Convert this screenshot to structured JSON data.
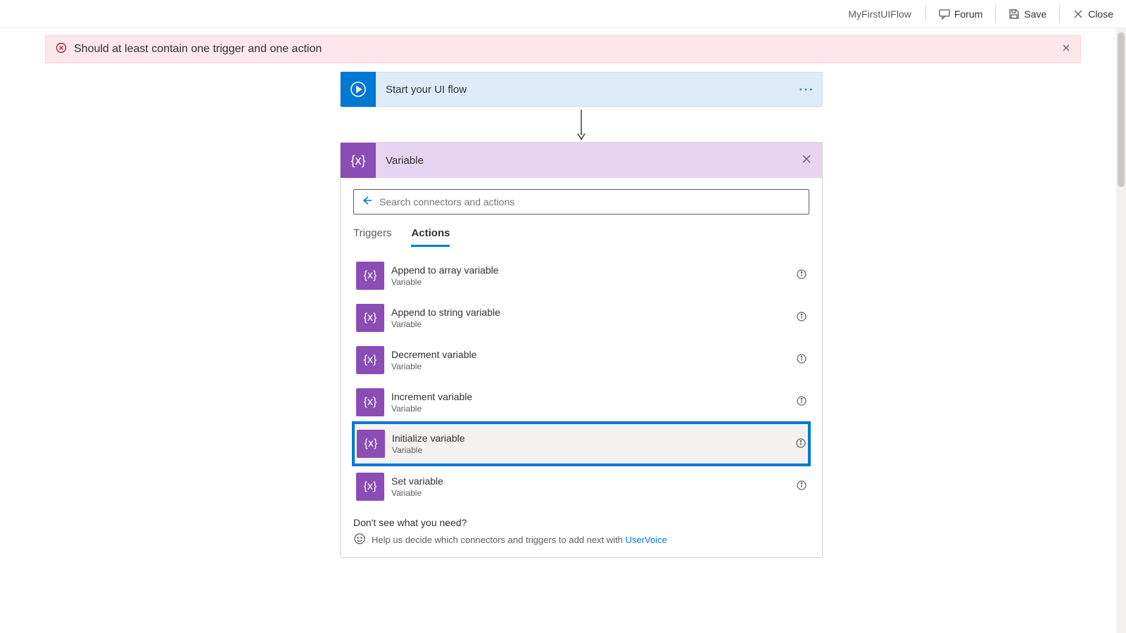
{
  "topbar": {
    "flow_name": "MyFirstUIFlow",
    "forum_label": "Forum",
    "save_label": "Save",
    "close_label": "Close"
  },
  "errorbar": {
    "message": "Should at least contain one trigger and one action"
  },
  "trigger_step": {
    "title": "Start your UI flow"
  },
  "variable_card": {
    "title": "Variable",
    "search_placeholder": "Search connectors and actions",
    "tabs": {
      "triggers": "Triggers",
      "actions": "Actions"
    },
    "actions": [
      {
        "title": "Append to array variable",
        "subtitle": "Variable",
        "highlighted": false
      },
      {
        "title": "Append to string variable",
        "subtitle": "Variable",
        "highlighted": false
      },
      {
        "title": "Decrement variable",
        "subtitle": "Variable",
        "highlighted": false
      },
      {
        "title": "Increment variable",
        "subtitle": "Variable",
        "highlighted": false
      },
      {
        "title": "Initialize variable",
        "subtitle": "Variable",
        "highlighted": true
      },
      {
        "title": "Set variable",
        "subtitle": "Variable",
        "highlighted": false
      }
    ],
    "footer": {
      "question": "Don't see what you need?",
      "help_text": "Help us decide which connectors and triggers to add next with ",
      "help_link_label": "UserVoice"
    }
  }
}
